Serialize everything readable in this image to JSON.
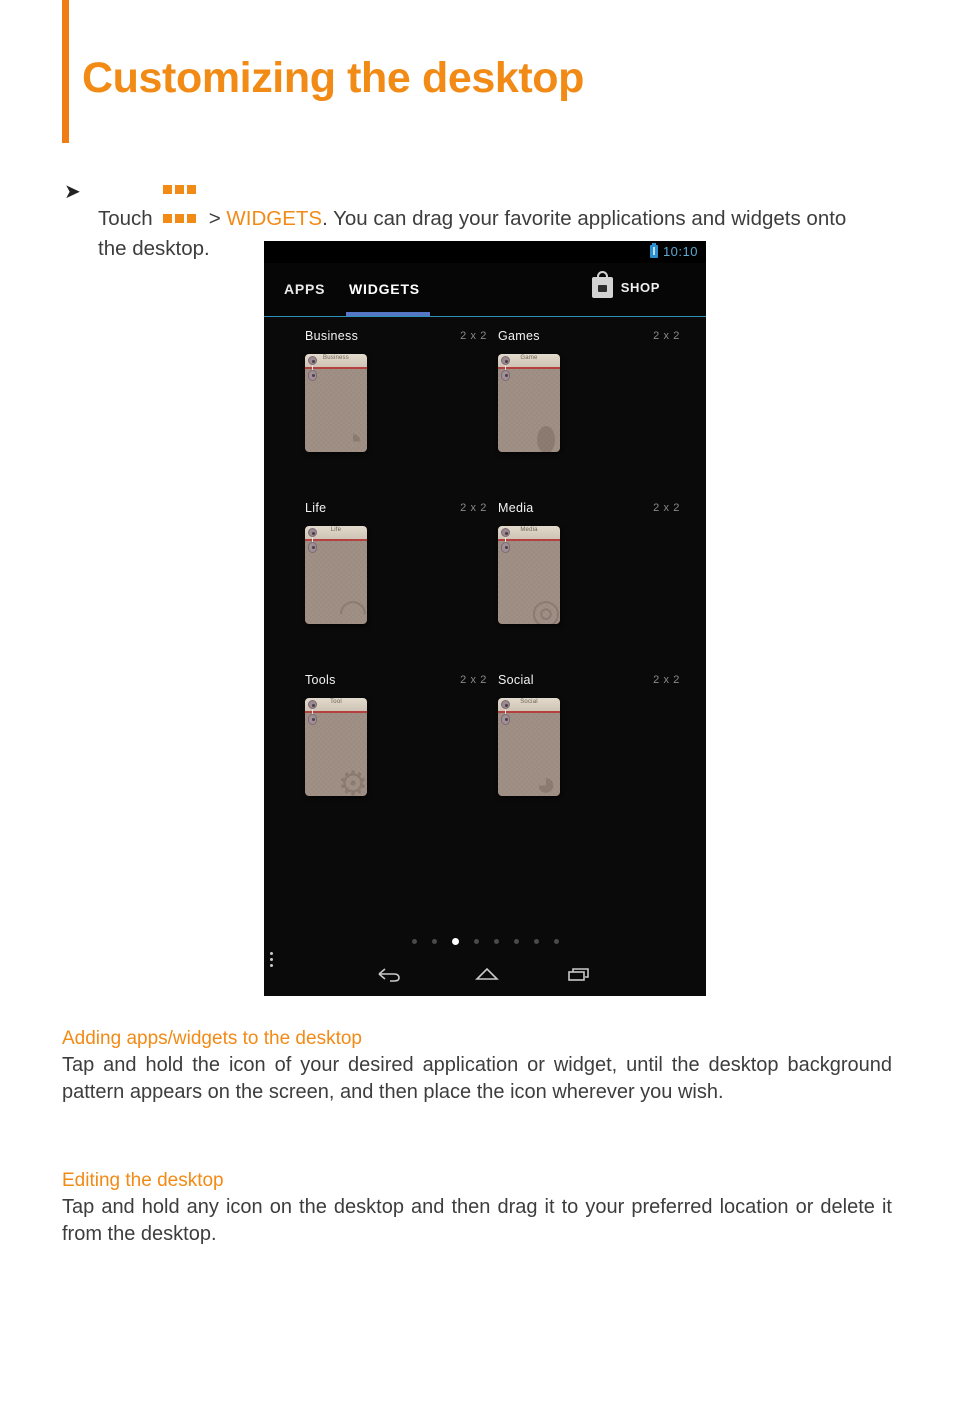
{
  "page": {
    "title": "Customizing the desktop",
    "accent_color": "#f28a16"
  },
  "instruction": {
    "arrow": "➤",
    "lead": "Touch",
    "icon": "apps-grid-icon",
    "separator": ">",
    "target": "WIDGETS",
    "rest": ". You can drag your favorite applications and widgets onto the desktop."
  },
  "device": {
    "statusbar": {
      "battery_icon": "battery-icon",
      "time": "10:10"
    },
    "tabs": [
      {
        "label": "APPS",
        "selected": false
      },
      {
        "label": "WIDGETS",
        "selected": true
      }
    ],
    "shop": {
      "icon": "shopping-bag-icon",
      "label": "SHOP"
    },
    "widgets": [
      {
        "name": "Business",
        "size": "2 x 2",
        "tile_label": "Business",
        "watermark": "◔"
      },
      {
        "name": "Games",
        "size": "2 x 2",
        "tile_label": "Game",
        "watermark": "⬮"
      },
      {
        "name": "Life",
        "size": "2 x 2",
        "tile_label": "Life",
        "watermark": "◠"
      },
      {
        "name": "Media",
        "size": "2 x 2",
        "tile_label": "Media",
        "watermark": "◎"
      },
      {
        "name": "Tools",
        "size": "2 x 2",
        "tile_label": "Tool",
        "watermark": "⚙"
      },
      {
        "name": "Social",
        "size": "2 x 2",
        "tile_label": "Social",
        "watermark": "◕"
      }
    ],
    "page_dots": {
      "count": 8,
      "active_index": 2
    },
    "navbar": [
      {
        "name": "back-button",
        "icon": "back-arrow-icon"
      },
      {
        "name": "home-button",
        "icon": "home-icon"
      },
      {
        "name": "recents-button",
        "icon": "recents-icon"
      },
      {
        "name": "overflow-menu-button",
        "icon": "overflow-menu-icon"
      }
    ]
  },
  "sections": [
    {
      "heading": "Adding apps/widgets to the desktop",
      "body": "Tap and hold the icon of your desired application or widget, until the desktop background pattern appears on the screen, and then place the icon wherever you wish."
    },
    {
      "heading": "Editing the desktop",
      "body": "Tap and hold any icon on the desktop and then drag it to your preferred location or delete it from the desktop."
    }
  ]
}
